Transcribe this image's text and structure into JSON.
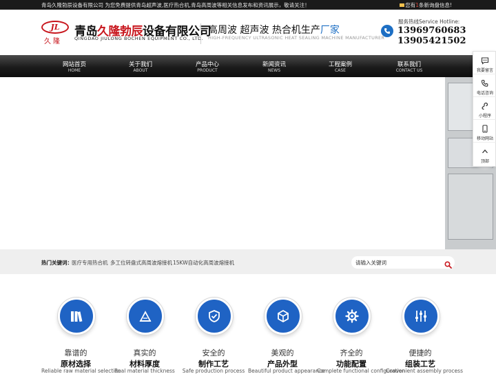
{
  "topbar": {
    "intro": "青岛久隆勃辰设备有限公司 为您免费提供青岛超声波,医疗热合机,青岛高周波等相关信息发布和资讯展示，敬请关注！",
    "notice_prefix": "您有",
    "notice_highlight": "1",
    "notice_suffix": "条新询盘信息!"
  },
  "header": {
    "logo_mark": "JL",
    "logo_small": "久隆",
    "company_cn_a": "青岛",
    "company_cn_b": "久隆勃辰",
    "company_cn_c": "设备有限公司",
    "company_en": "QINGDAO JIULONG BOCHEN EQUIPMENT CO., LTD.",
    "slogan_main": "高周波 超声波 热合机生产",
    "slogan_accent": "厂家",
    "slogan_en": "HIGH-FREQUENCY ULTRASONIC HEAT SEALING MACHINE MANUFACTURER",
    "hotline_label": "服务热线Service Hotline:",
    "phone1": "13969760683",
    "phone2": "13905421502"
  },
  "nav": [
    {
      "cn": "网站首页",
      "en": "HOME"
    },
    {
      "cn": "关于我们",
      "en": "ABOUT"
    },
    {
      "cn": "产品中心",
      "en": "PRODUCT"
    },
    {
      "cn": "新闻资讯",
      "en": "NEWS"
    },
    {
      "cn": "工程案例",
      "en": "CASE"
    },
    {
      "cn": "联系我们",
      "en": "CONTACT US"
    }
  ],
  "hot": {
    "label": "热门关键词：",
    "keywords": [
      "医疗专用热合机",
      "多工位转盘式高周波熔接机",
      "15KW自动化高周波熔接机"
    ]
  },
  "search": {
    "placeholder": "请输入关键词",
    "icon": "search-icon"
  },
  "features": [
    {
      "line1": "靠谱的",
      "line2": "原材选择",
      "en": "Reliable raw material selection",
      "icon": "books-icon"
    },
    {
      "line1": "真实的",
      "line2": "材料厚度",
      "en": "Real material thickness",
      "icon": "ruler-icon"
    },
    {
      "line1": "安全的",
      "line2": "制作工艺",
      "en": "Safe production process",
      "icon": "shield-check-icon"
    },
    {
      "line1": "美观的",
      "line2": "产品外型",
      "en": "Beautiful product appearance",
      "icon": "cube-icon"
    },
    {
      "line1": "齐全的",
      "line2": "功能配置",
      "en": "Complete functional configuration",
      "icon": "gear-icon"
    },
    {
      "line1": "便捷的",
      "line2": "组装工艺",
      "en": "Convenient assembly process",
      "icon": "sliders-icon"
    }
  ],
  "float_bar": [
    {
      "label": "我要留言",
      "icon": "message-icon"
    },
    {
      "label": "电话咨询",
      "icon": "phone-icon"
    },
    {
      "label": "小程序",
      "icon": "mini-program-icon"
    },
    {
      "label": "移动网站",
      "icon": "mobile-icon"
    },
    {
      "label": "顶部",
      "icon": "arrow-up-icon"
    }
  ],
  "colors": {
    "brand_red": "#c8161d",
    "accent_blue": "#1f63c4",
    "nav_dark": "#1b1b1b"
  }
}
